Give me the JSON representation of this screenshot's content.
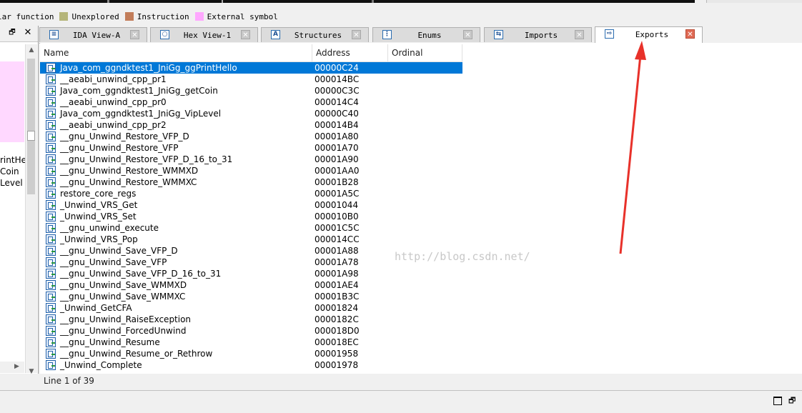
{
  "legend": [
    {
      "label": "lar function",
      "color": "",
      "show_swatch": false
    },
    {
      "label": "Unexplored",
      "color": "#b5b57a",
      "show_swatch": true
    },
    {
      "label": "Instruction",
      "color": "#c27d5a",
      "show_swatch": true
    },
    {
      "label": "External symbol",
      "color": "#ffa8ff",
      "show_swatch": true
    }
  ],
  "left_pane": {
    "restore_glyph": "🗗",
    "close_glyph": "✕",
    "lines": [
      "rintHe",
      "Coin",
      "Level"
    ]
  },
  "tabs": [
    {
      "label": "IDA View-A",
      "icon": "ida-view-icon",
      "icon_glyph": "≡",
      "active": false
    },
    {
      "label": "Hex View-1",
      "icon": "hex-view-icon",
      "icon_glyph": "○",
      "active": false
    },
    {
      "label": "Structures",
      "icon": "structures-icon",
      "icon_glyph": "A",
      "active": false
    },
    {
      "label": "Enums",
      "icon": "enums-icon",
      "icon_glyph": "⋮",
      "active": false
    },
    {
      "label": "Imports",
      "icon": "imports-icon",
      "icon_glyph": "⇆",
      "active": false
    },
    {
      "label": "Exports",
      "icon": "exports-icon",
      "icon_glyph": "⇨",
      "active": true
    }
  ],
  "tab_close_glyph": "✕",
  "columns": {
    "name": "Name",
    "address": "Address",
    "ordinal": "Ordinal"
  },
  "exports": [
    {
      "name": "Java_com_ggndktest1_JniGg_ggPrintHello",
      "address": "00000C24",
      "selected": true
    },
    {
      "name": "__aeabi_unwind_cpp_pr1",
      "address": "000014BC"
    },
    {
      "name": "Java_com_ggndktest1_JniGg_getCoin",
      "address": "00000C3C"
    },
    {
      "name": "__aeabi_unwind_cpp_pr0",
      "address": "000014C4"
    },
    {
      "name": "Java_com_ggndktest1_JniGg_VipLevel",
      "address": "00000C40"
    },
    {
      "name": "__aeabi_unwind_cpp_pr2",
      "address": "000014B4"
    },
    {
      "name": "__gnu_Unwind_Restore_VFP_D",
      "address": "00001A80"
    },
    {
      "name": "__gnu_Unwind_Restore_VFP",
      "address": "00001A70"
    },
    {
      "name": "__gnu_Unwind_Restore_VFP_D_16_to_31",
      "address": "00001A90"
    },
    {
      "name": "__gnu_Unwind_Restore_WMMXD",
      "address": "00001AA0"
    },
    {
      "name": "__gnu_Unwind_Restore_WMMXC",
      "address": "00001B28"
    },
    {
      "name": "restore_core_regs",
      "address": "00001A5C"
    },
    {
      "name": "_Unwind_VRS_Get",
      "address": "00001044"
    },
    {
      "name": "_Unwind_VRS_Set",
      "address": "000010B0"
    },
    {
      "name": "__gnu_unwind_execute",
      "address": "00001C5C"
    },
    {
      "name": "_Unwind_VRS_Pop",
      "address": "000014CC"
    },
    {
      "name": "__gnu_Unwind_Save_VFP_D",
      "address": "00001A88"
    },
    {
      "name": "__gnu_Unwind_Save_VFP",
      "address": "00001A78"
    },
    {
      "name": "__gnu_Unwind_Save_VFP_D_16_to_31",
      "address": "00001A98"
    },
    {
      "name": "__gnu_Unwind_Save_WMMXD",
      "address": "00001AE4"
    },
    {
      "name": "__gnu_Unwind_Save_WMMXC",
      "address": "00001B3C"
    },
    {
      "name": "_Unwind_GetCFA",
      "address": "00001824"
    },
    {
      "name": "__gnu_Unwind_RaiseException",
      "address": "0000182C"
    },
    {
      "name": "__gnu_Unwind_ForcedUnwind",
      "address": "000018D0"
    },
    {
      "name": "__gnu_Unwind_Resume",
      "address": "000018EC"
    },
    {
      "name": "__gnu_Unwind_Resume_or_Rethrow",
      "address": "00001958"
    },
    {
      "name": "_Unwind_Complete",
      "address": "00001978"
    }
  ],
  "watermark": "http://blog.csdn.net/",
  "status": "Line 1 of 39",
  "colors": {
    "selection": "#0078d7",
    "arrow": "#e8312a"
  }
}
